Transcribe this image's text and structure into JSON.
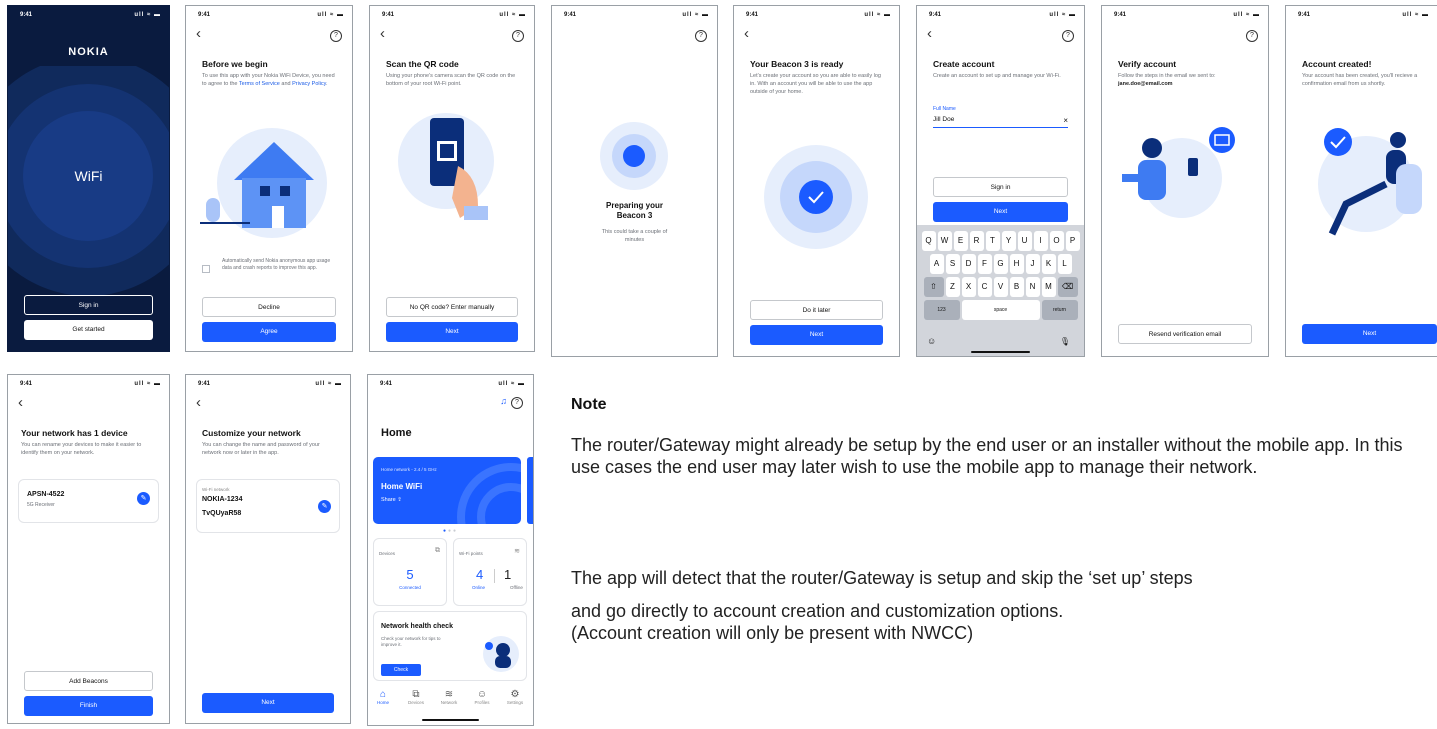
{
  "status": {
    "time": "9:41",
    "signal": "ull ≈ ▬"
  },
  "screens": {
    "splash": {
      "logo": "NOKIA",
      "wifi_label": "WiFi",
      "sign_in": "Sign in",
      "get_started": "Get started"
    },
    "before": {
      "title": "Before we begin",
      "desc_1": "To use this app with your Nokia WiFi Device, you need to agree to the ",
      "terms": "Terms of Service",
      "and": " and ",
      "privacy": "Privacy Policy",
      "desc_end": ".",
      "checkbox_label": "Automatically send Nokia anonymous app usage data and crash reports to improve this app.",
      "decline": "Decline",
      "agree": "Agree"
    },
    "qr": {
      "title": "Scan the QR code",
      "desc": "Using your phone's camera scan the QR code on the bottom of your root Wi-Fi point.",
      "manual": "No QR code? Enter manually",
      "next": "Next"
    },
    "preparing": {
      "title": "Preparing your Beacon 3",
      "desc": "This could take a couple of minutes"
    },
    "ready": {
      "title": "Your Beacon 3 is ready",
      "desc": "Let's create your account so you are able to easily log in. With an account you will be able to use the app outside of your home.",
      "later": "Do it later",
      "next": "Next"
    },
    "create": {
      "title": "Create account",
      "desc": "Create an account to set up and manage your Wi-Fi.",
      "field_label": "Full Name",
      "field_value": "Jill Doe",
      "clear": "×",
      "sign_in": "Sign in",
      "next": "Next",
      "kb_row1": [
        "Q",
        "W",
        "E",
        "R",
        "T",
        "Y",
        "U",
        "I",
        "O",
        "P"
      ],
      "kb_row2": [
        "A",
        "S",
        "D",
        "F",
        "G",
        "H",
        "J",
        "K",
        "L"
      ],
      "kb_row3": [
        "Z",
        "X",
        "C",
        "V",
        "B",
        "N",
        "M"
      ],
      "kb_123": "123",
      "kb_space": "space",
      "kb_return": "return"
    },
    "verify": {
      "title": "Verify account",
      "desc": "Follow the steps in the email we sent to:",
      "email": "jane.doe@email.com",
      "resend": "Resend verification email"
    },
    "created": {
      "title": "Account created!",
      "desc": "Your account has been created, you'll recieve a confirmation email from us shortly.",
      "next": "Next"
    },
    "network": {
      "title": "Your network has 1 device",
      "desc": "You can rename your devices to make it easier to identify them on your network.",
      "device_name": "APSN-4522",
      "device_type": "5G Receiver",
      "add": "Add Beacons",
      "finish": "Finish"
    },
    "customize": {
      "title": "Customize your network",
      "desc": "You can change the name and password of your network now or later in the app.",
      "label": "Wi-Fi network",
      "ssid": "NOKIA-1234",
      "password": "TvQUyaR58",
      "next": "Next"
    },
    "home": {
      "title": "Home",
      "net_label": "Home network - 2.4 / 5 GHz",
      "net_name": "Home WiFi",
      "share": "Share ⇪",
      "devices_label": "Devices",
      "devices_count": "5",
      "devices_status": "Connected",
      "wifi_label": "Wi-Fi points",
      "online_count": "4",
      "online_label": "Online",
      "offline_count": "1",
      "offline_label": "Offline",
      "health_title": "Network health check",
      "health_desc": "Check your network for tips to improve it.",
      "check": "Check",
      "nav": [
        "Home",
        "Devices",
        "Network",
        "Profiles",
        "Settings"
      ]
    }
  },
  "note": {
    "title": "Note",
    "p1": "The router/Gateway might already be setup by the end user or an installer without the mobile app. In this use cases the end user may later wish to use the mobile app to manage their network.",
    "p2a": "The app will detect that the router/Gateway is setup and skip the ‘set up’ steps",
    "p2b": "and go directly to account creation and customization options.",
    "p2c": "(Account creation will only be present with NWCC)"
  }
}
